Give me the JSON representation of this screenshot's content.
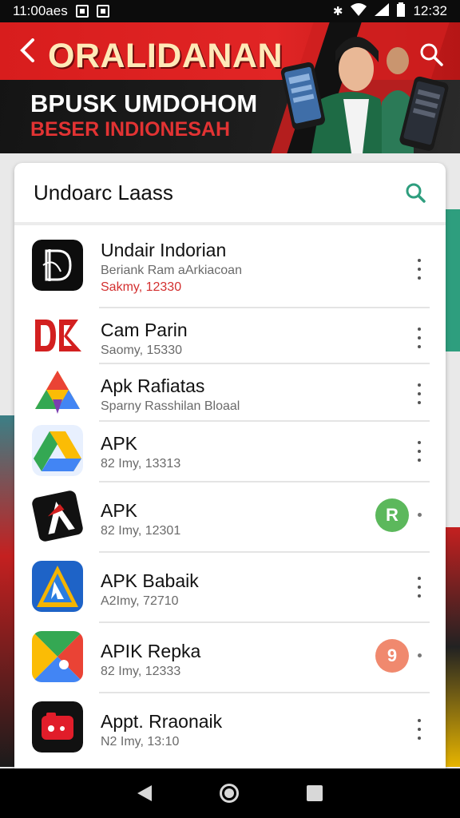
{
  "status_bar": {
    "left_text": "11:00aes",
    "time": "12:32",
    "icons": [
      "gallery-icon",
      "image-icon",
      "bluetooth-icon",
      "wifi-icon",
      "signal-icon",
      "battery-icon"
    ]
  },
  "banner": {
    "title": "ORALIDANAN",
    "subtitle_line1": "BPUSK UMDOHOM",
    "subtitle_line2": "BESER INDIONESAH",
    "colors": {
      "red": "#d81d1d",
      "dark": "#141414",
      "title": "#ffe9b8"
    }
  },
  "card": {
    "title": "Undoarc Laass",
    "accent": "#2e9e7e"
  },
  "apps": [
    {
      "name": "Undair Indorian",
      "line2": "Beriank Ram aArkiacoan",
      "line3": "Sakmy, 12330",
      "icon": "d-logo-icon",
      "action": "menu"
    },
    {
      "name": "Cam Parin",
      "line2": "Saomy, 15330",
      "icon": "db-logo-icon",
      "action": "menu"
    },
    {
      "name": "Apk Rafiatas",
      "line2": "Sparny Rasshilan Bloaal",
      "icon": "colorful-a-icon",
      "action": "menu"
    },
    {
      "name": "APK",
      "line2": "82 Imy, 13313",
      "icon": "drive-triangle-icon",
      "action": "menu"
    },
    {
      "name": "APK",
      "line2": "82 Imy, 12301",
      "icon": "red-a-icon",
      "action": "badge",
      "badge": "R",
      "badge_color": "#5cb85c"
    },
    {
      "name": "APK Babaik",
      "line2": "A2Imy, 72710",
      "icon": "blue-a-icon",
      "action": "menu"
    },
    {
      "name": "APIK Repka",
      "line2": "82 Imy, 12333",
      "icon": "play-store-icon",
      "action": "badge",
      "badge": "9",
      "badge_color": "#f0896e"
    },
    {
      "name": "Appt. Rraonaik",
      "line2": "N2 Imy, 13:10",
      "icon": "red-camera-icon",
      "action": "menu"
    }
  ],
  "nav_bar": {
    "buttons": [
      "back-icon",
      "home-icon",
      "recents-icon"
    ]
  }
}
